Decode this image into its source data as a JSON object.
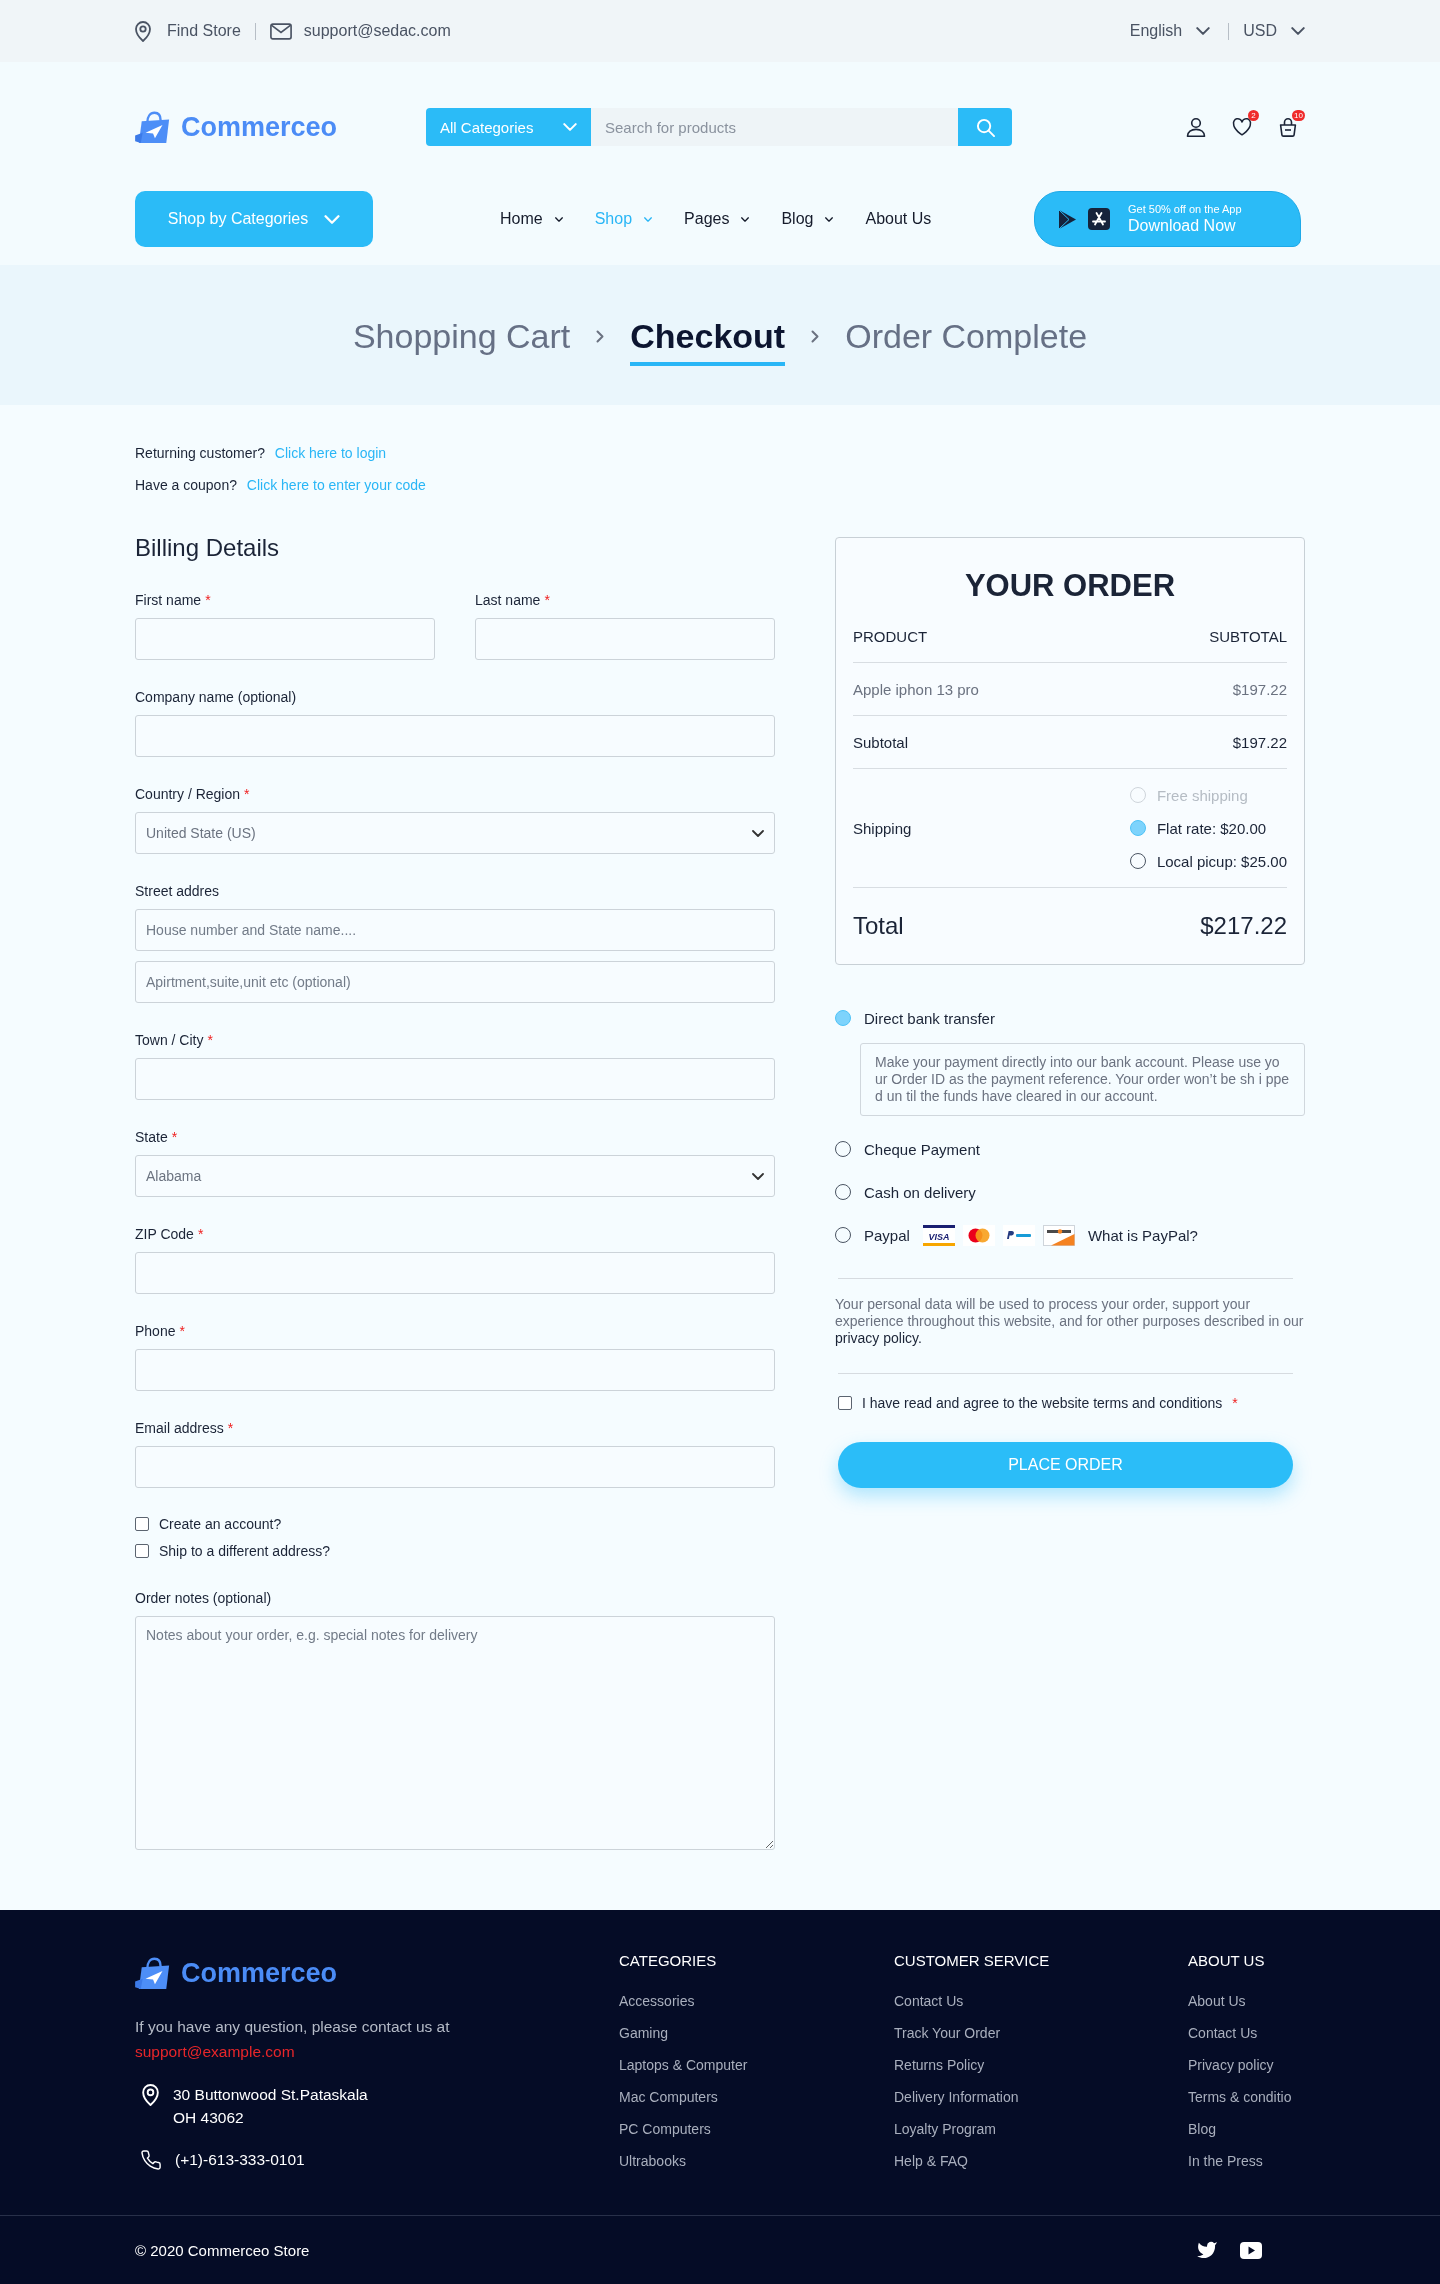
{
  "top_bar": {
    "store_link": "Find Store",
    "email": "support@sedac.com",
    "language": "English",
    "currency": "USD"
  },
  "header": {
    "logo": "Commerceo",
    "category_dropdown": "All Categories",
    "search": {
      "placeholder": "Search for products"
    },
    "wishlist_count": "2",
    "cart_count": "10"
  },
  "nav": {
    "categories_button": "Shop by Categories",
    "items": [
      {
        "label": "Home",
        "selected": false,
        "dropdown": true
      },
      {
        "label": "Shop",
        "selected": true,
        "dropdown": true
      },
      {
        "label": "Pages",
        "selected": false,
        "dropdown": true
      },
      {
        "label": "Blog",
        "selected": false,
        "dropdown": true
      },
      {
        "label": "About Us",
        "selected": false,
        "dropdown": false
      }
    ],
    "app_promo": {
      "caption": "Get 50% off on the App",
      "label": "Download Now"
    }
  },
  "breadcrumb": {
    "steps": [
      {
        "label": "Shopping Cart",
        "selected": false
      },
      {
        "label": "Checkout",
        "selected": true
      },
      {
        "label": "Order Complete",
        "selected": false
      }
    ]
  },
  "notices": [
    {
      "text": "Returning customer?",
      "link": "Click here to login"
    },
    {
      "text": "Have a coupon?",
      "link": "Click here to enter your code"
    }
  ],
  "billing": {
    "title": "Billing Details",
    "rows": [
      [
        {
          "label": "First name",
          "required_mark": "*",
          "inputs": [
            {
              "kind": "text"
            }
          ]
        },
        {
          "label": "Last name",
          "required_mark": "*",
          "inputs": [
            {
              "kind": "text"
            }
          ]
        }
      ],
      [
        {
          "label": "Company name (optional)",
          "inputs": [
            {
              "kind": "text"
            }
          ]
        }
      ],
      [
        {
          "label": "Country / Region",
          "required_mark": "*",
          "inputs": [
            {
              "kind": "select",
              "value": "United State (US)"
            }
          ]
        }
      ],
      [
        {
          "label": "Street addres",
          "inputs": [
            {
              "kind": "text",
              "placeholder": "House number and State name...."
            },
            {
              "kind": "text",
              "placeholder": "Apirtment,suite,unit etc (optional)"
            }
          ]
        }
      ],
      [
        {
          "label": "Town / City",
          "required_mark": "*",
          "inputs": [
            {
              "kind": "text"
            }
          ]
        }
      ],
      [
        {
          "label": "State",
          "required_mark": "*",
          "inputs": [
            {
              "kind": "select",
              "value": "Alabama"
            }
          ]
        }
      ],
      [
        {
          "label": "ZIP Code",
          "required_mark": "*",
          "inputs": [
            {
              "kind": "text"
            }
          ]
        }
      ],
      [
        {
          "label": "Phone",
          "required_mark": "*",
          "inputs": [
            {
              "kind": "text"
            }
          ]
        }
      ],
      [
        {
          "label": "Email address",
          "required_mark": "*",
          "inputs": [
            {
              "kind": "text"
            }
          ]
        }
      ]
    ],
    "checkboxes": [
      {
        "label": "Create an account?",
        "checked": false
      },
      {
        "label": "Ship to a different address?",
        "checked": false
      }
    ],
    "notes": {
      "label": "Order notes (optional)",
      "placeholder": "Notes about your order, e.g. special notes for delivery"
    }
  },
  "order": {
    "title": "YOUR ORDER",
    "columns": [
      "PRODUCT",
      "SUBTOTAL"
    ],
    "items": [
      {
        "name": "Apple iphon 13 pro",
        "price": "$197.22"
      }
    ],
    "subtotal": {
      "label": "Subtotal",
      "value": "$197.22"
    },
    "shipping": {
      "label": "Shipping",
      "options": [
        {
          "label": "Free shipping",
          "selected": false,
          "disabled": true
        },
        {
          "label": "Flat rate: $20.00",
          "selected": true,
          "disabled": false
        },
        {
          "label": "Local picup: $25.00",
          "selected": false,
          "disabled": false
        }
      ]
    },
    "total": {
      "label": "Total",
      "value": "$217.22"
    }
  },
  "payment": {
    "methods": [
      {
        "label": "Direct bank transfer",
        "selected": true,
        "description": "Make your payment directly into our bank account. Please use yo ur Order ID as the payment reference. Your order won’t be sh i ppe d un til the funds have cleared in our account."
      },
      {
        "label": "Cheque Payment",
        "selected": false
      },
      {
        "label": "Cash on delivery",
        "selected": false
      },
      {
        "label": "Paypal",
        "selected": false,
        "cards": [
          {
            "kind": "visa",
            "label": "VISA"
          },
          {
            "kind": "mastercard"
          },
          {
            "kind": "paypal"
          },
          {
            "kind": "discover"
          }
        ],
        "link": "What is PayPal?"
      }
    ],
    "privacy": {
      "text": "Your personal data will be used to process your order, support your experience throughout this website, and for other purposes described in our",
      "link": "privacy policy."
    },
    "terms": {
      "label": "I have read and agree to the website terms and conditions",
      "required_mark": "*",
      "checked": false
    },
    "submit": "PLACE ORDER"
  },
  "footer": {
    "logo": "Commerceo",
    "contact_text": "If you have any question, please contact us at",
    "contact_email": "support@example.com",
    "address_lines": [
      "30 Buttonwood St.Pataskala",
      "OH 43062"
    ],
    "phone": "(+1)-613-333-0101",
    "columns": [
      {
        "title": "CATEGORIES",
        "links": [
          "Accessories",
          "Gaming",
          "Laptops & Computer",
          "Mac Computers",
          "PC Computers",
          "Ultrabooks"
        ]
      },
      {
        "title": "CUSTOMER SERVICE",
        "links": [
          "Contact Us",
          "Track Your Order",
          "Returns Policy",
          "Delivery Information",
          "Loyalty Program",
          "Help & FAQ"
        ]
      },
      {
        "title": "ABOUT US",
        "links": [
          "About Us",
          "Contact Us",
          "Privacy policy",
          "Terms & conditio",
          "Blog",
          "In the Press"
        ]
      }
    ],
    "copyright": "© 2020 Commerceo Store"
  }
}
